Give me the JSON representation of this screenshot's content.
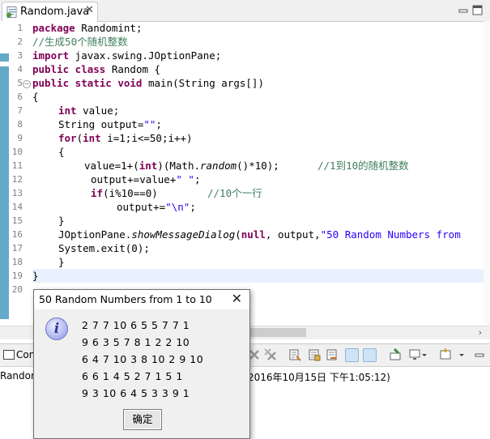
{
  "editor": {
    "tab_title": "Random.java",
    "tab_close": "✕",
    "line_numbers": [
      "1",
      "2",
      "3",
      "4",
      "5",
      "6",
      "7",
      "8",
      "9",
      "10",
      "11",
      "12",
      "13",
      "14",
      "15",
      "16",
      "17",
      "18",
      "19",
      "20"
    ]
  },
  "code": {
    "l1_kw": "package",
    "l1_rest": " Randomint;",
    "l2": "//生成50个随机整数",
    "l3_kw": "import",
    "l3_rest": " javax.swing.JOptionPane;",
    "l4_kw": "public class",
    "l4_rest": " Random {",
    "l5_kw": "public static void",
    "l5_rest": " main(String args[])",
    "l6": "{",
    "l7_kw": "int",
    "l7_rest": " value;",
    "l8_a": "String output=",
    "l8_str": "\"\"",
    "l8_b": ";",
    "l9_kw1": "for",
    "l9_a": "(",
    "l9_kw2": "int",
    "l9_b": " i=1;i<=50;i++)",
    "l10": "{",
    "l11_a": "value=1+(",
    "l11_kw": "int",
    "l11_b": ")(Math.",
    "l11_it": "random",
    "l11_c": "()*10);",
    "l11_cm": "//1到10的随机整数",
    "l12_a": "output+=value+",
    "l12_str": "\" \"",
    "l12_b": ";",
    "l13_kw": "if",
    "l13_a": "(i%10==0)",
    "l13_cm": "//10个一行",
    "l14_a": "output+=",
    "l14_str": "\"\\n\"",
    "l14_b": ";",
    "l15": "}",
    "l16_a": "JOptionPane.",
    "l16_it": "showMessageDialog",
    "l16_b": "(",
    "l16_kw": "null",
    "l16_c": ", output,",
    "l16_str": "\"50 Random Numbers from",
    "l17": "System.exit(0);",
    "l18": "}",
    "l19": "}"
  },
  "bottom": {
    "tab_label": "Con",
    "console_name": "Random",
    "console_time": "2016年10月15日 下午1:05:12)"
  },
  "dialog": {
    "title": "50 Random Numbers from 1 to 10",
    "close": "✕",
    "icon_glyph": "i",
    "lines": [
      "2 7 7 10 6 5 5 7 7 1",
      "9 6 3 5 7 8 1 2 2 10",
      "6 4 7 10 3 8 10 2 9 10",
      "6 6 1 4 5 2 7 1 5 1",
      "9 3 10 6 4 5 3 3 9 1"
    ],
    "ok_label": "确定"
  },
  "colors": {
    "keyword": "#7f0055",
    "comment": "#3f7f5f",
    "string": "#2a00ff",
    "ruler_mark": "#65a9c9",
    "current_line": "#e8f2fe"
  }
}
